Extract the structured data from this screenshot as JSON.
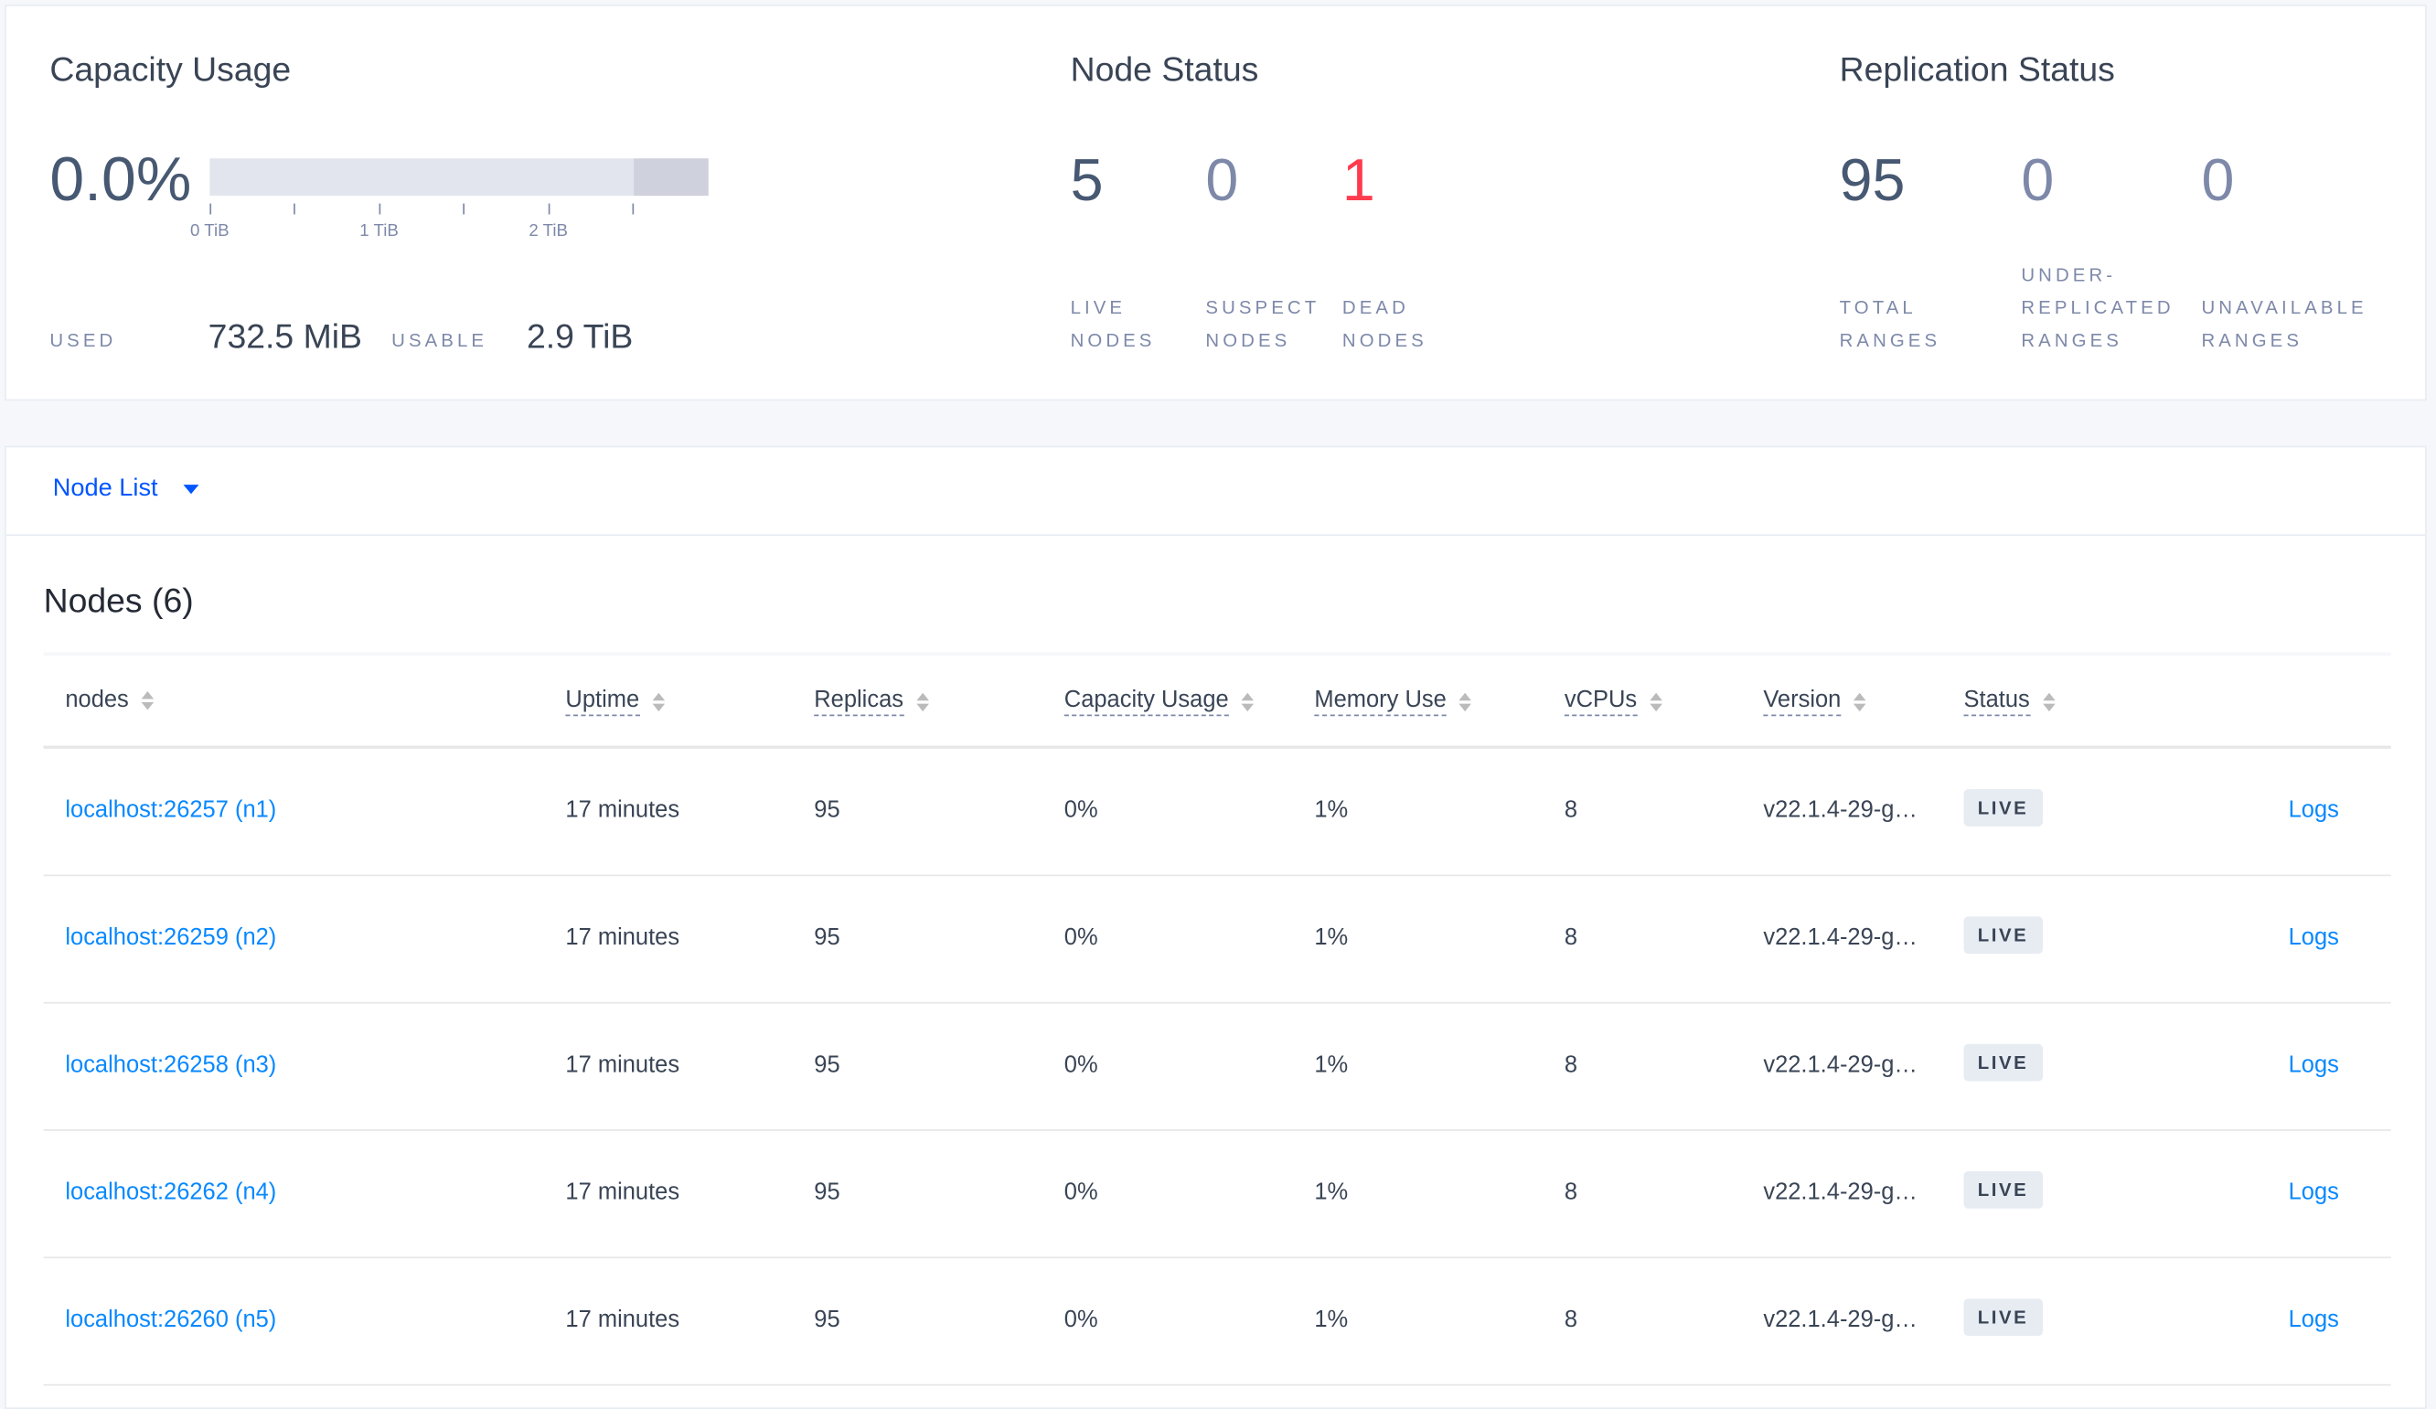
{
  "capacity": {
    "title": "Capacity Usage",
    "percent": "0.0%",
    "used_fraction": 0.0,
    "axis_ticks": [
      "0 TiB",
      "1 TiB",
      "2 TiB"
    ],
    "used_label": "USED",
    "used_value": "732.5 MiB",
    "usable_label": "USABLE",
    "usable_value": "2.9 TiB"
  },
  "node_status": {
    "title": "Node Status",
    "live": "5",
    "live_label1": "LIVE",
    "live_label2": "NODES",
    "suspect": "0",
    "suspect_label1": "SUSPECT",
    "suspect_label2": "NODES",
    "dead": "1",
    "dead_label1": "DEAD",
    "dead_label2": "NODES",
    "dead_color": "#ff3b4e"
  },
  "replication": {
    "title": "Replication Status",
    "total": "95",
    "total_label1": "TOTAL",
    "total_label2": "RANGES",
    "under": "0",
    "under_label1": "UNDER-",
    "under_label2": "REPLICATED",
    "under_label3": "RANGES",
    "unavail": "0",
    "unavail_label1": "UNAVAILABLE",
    "unavail_label2": "RANGES"
  },
  "view_select": {
    "label": "Node List"
  },
  "nodes_title": "Nodes (6)",
  "columns": [
    "nodes",
    "Uptime",
    "Replicas",
    "Capacity Usage",
    "Memory Use",
    "vCPUs",
    "Version",
    "Status"
  ],
  "rows": [
    {
      "node": "localhost:26257 (n1)",
      "uptime": "17 minutes",
      "replicas": "95",
      "capacity": "0%",
      "memory": "1%",
      "vcpus": "8",
      "version": "v22.1.4-29-g…",
      "status": "LIVE",
      "logs": "Logs"
    },
    {
      "node": "localhost:26259 (n2)",
      "uptime": "17 minutes",
      "replicas": "95",
      "capacity": "0%",
      "memory": "1%",
      "vcpus": "8",
      "version": "v22.1.4-29-g…",
      "status": "LIVE",
      "logs": "Logs"
    },
    {
      "node": "localhost:26258 (n3)",
      "uptime": "17 minutes",
      "replicas": "95",
      "capacity": "0%",
      "memory": "1%",
      "vcpus": "8",
      "version": "v22.1.4-29-g…",
      "status": "LIVE",
      "logs": "Logs"
    },
    {
      "node": "localhost:26262 (n4)",
      "uptime": "17 minutes",
      "replicas": "95",
      "capacity": "0%",
      "memory": "1%",
      "vcpus": "8",
      "version": "v22.1.4-29-g…",
      "status": "LIVE",
      "logs": "Logs"
    },
    {
      "node": "localhost:26260 (n5)",
      "uptime": "17 minutes",
      "replicas": "95",
      "capacity": "0%",
      "memory": "1%",
      "vcpus": "8",
      "version": "v22.1.4-29-g…",
      "status": "LIVE",
      "logs": "Logs"
    }
  ]
}
